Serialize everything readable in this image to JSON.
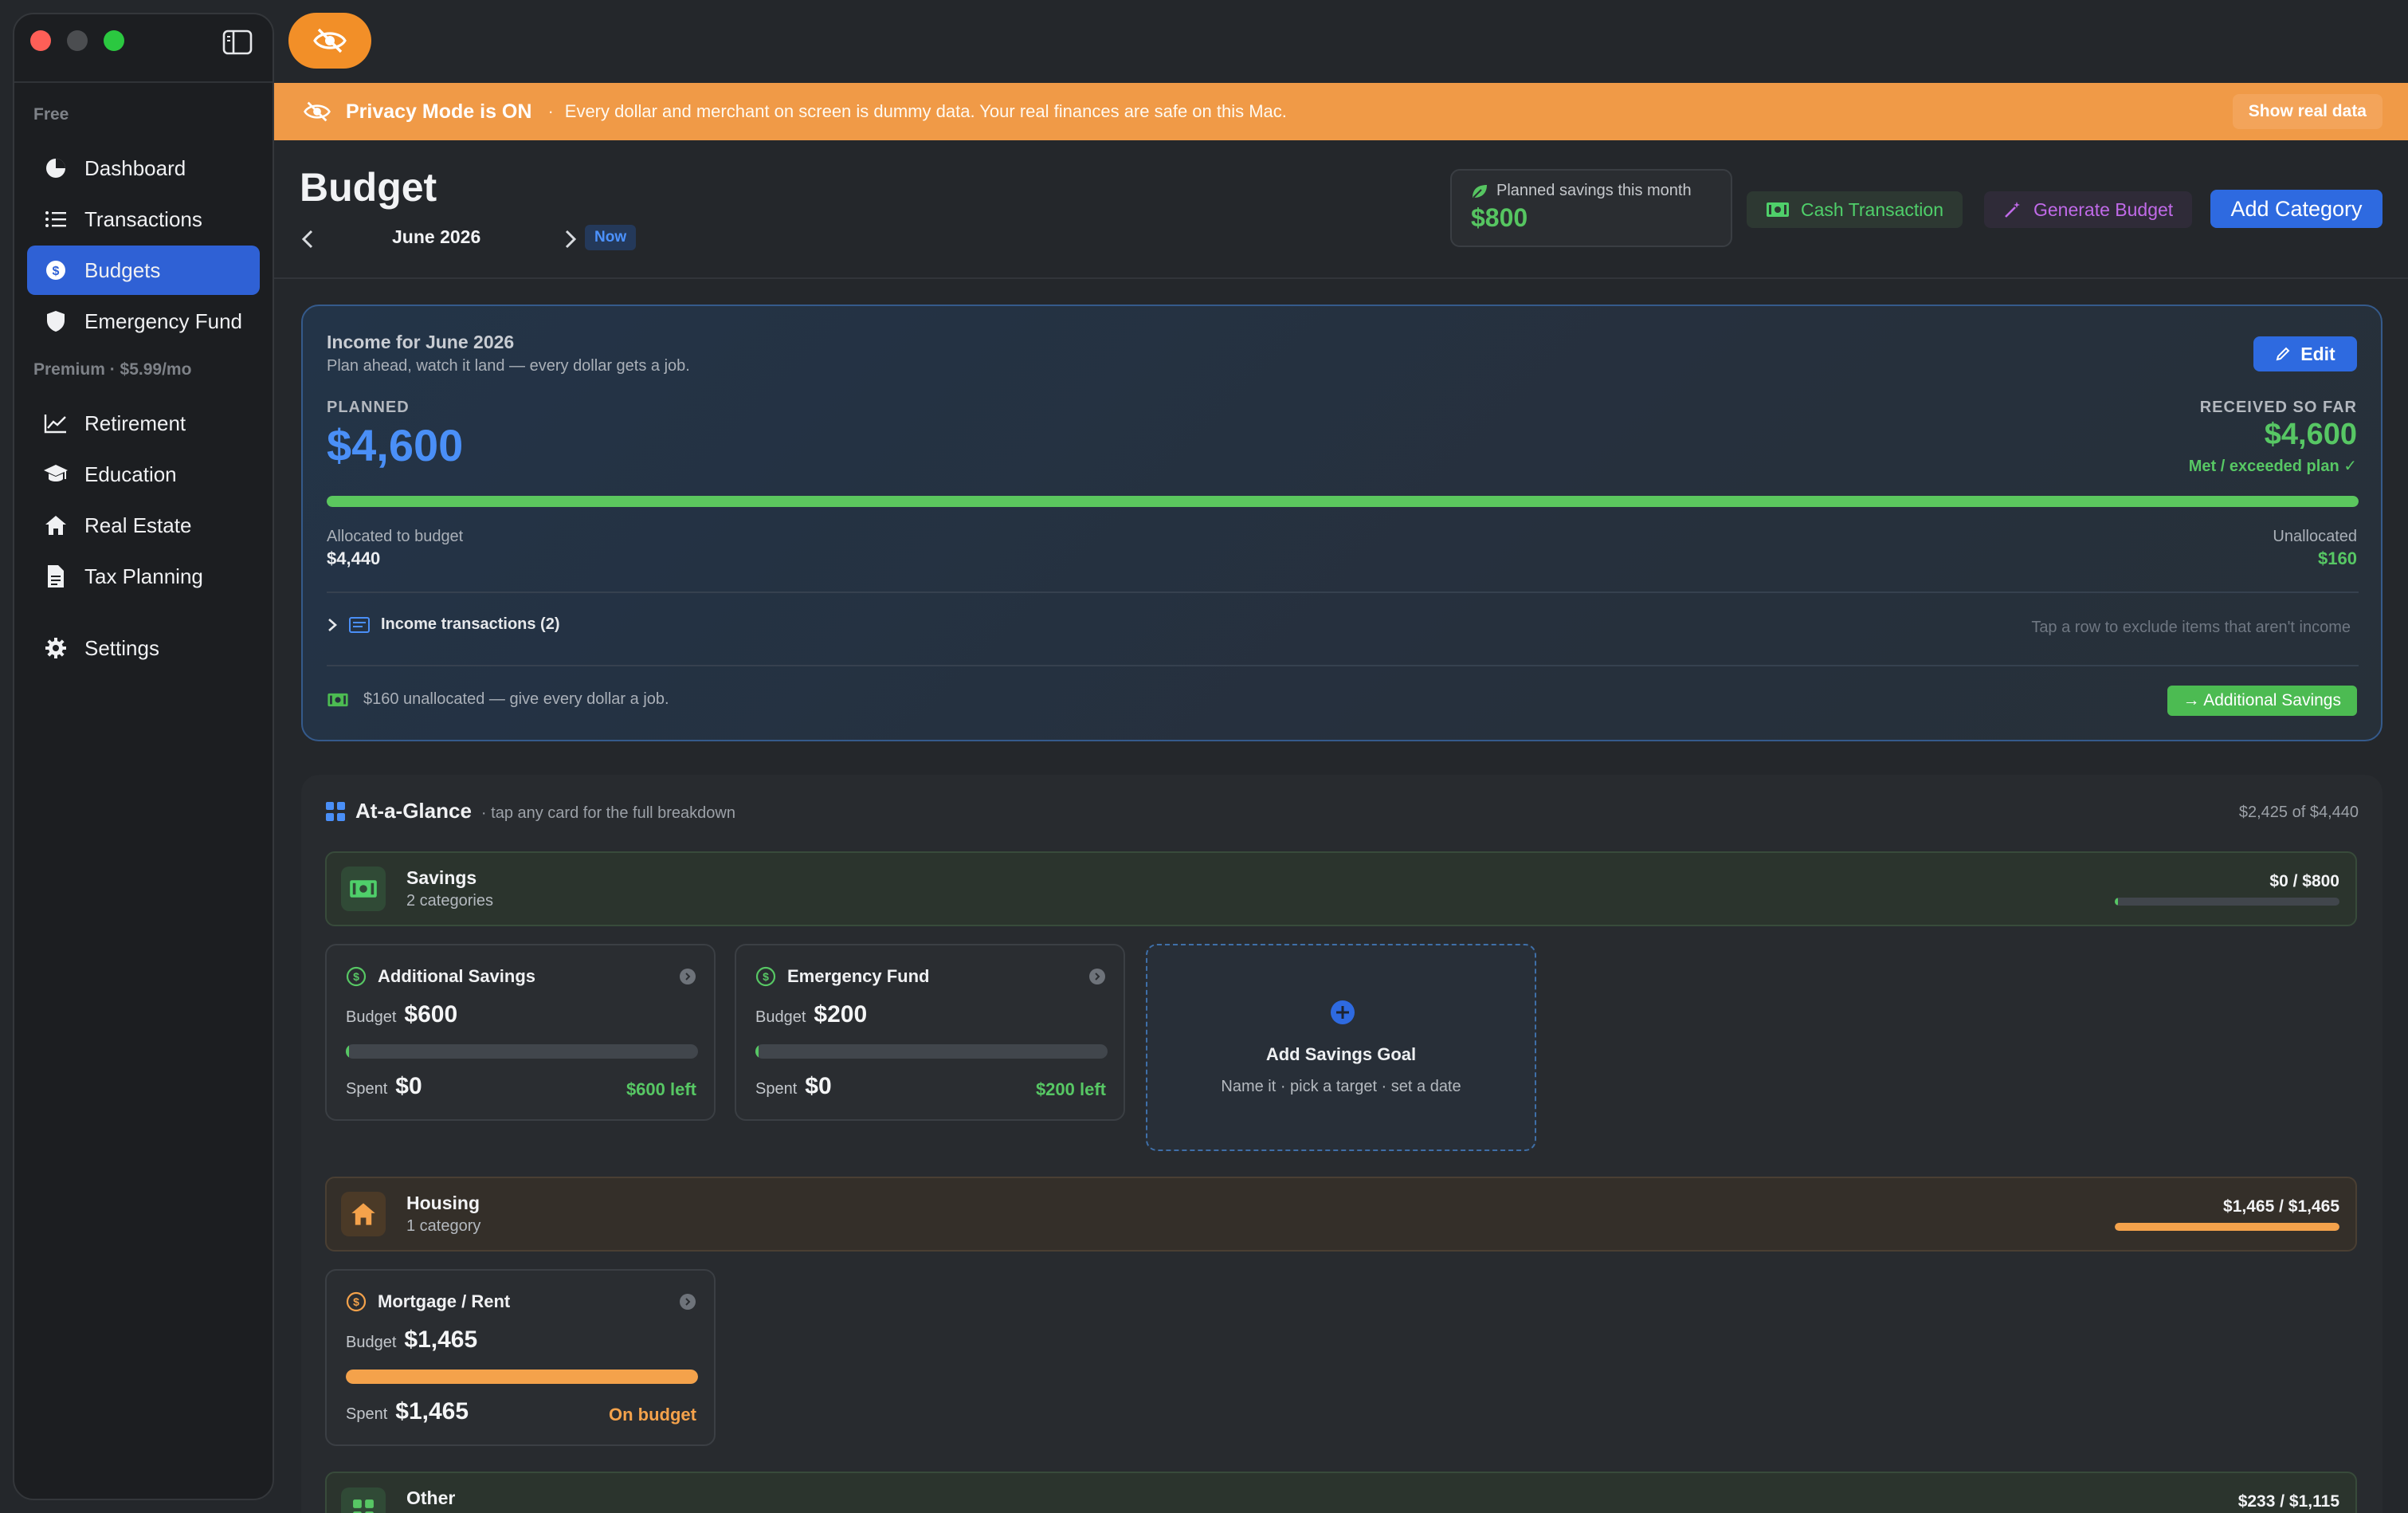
{
  "sidebar": {
    "sections": [
      {
        "title": "Free"
      },
      {
        "title": "Premium · $5.99/mo"
      }
    ],
    "items": [
      {
        "label": "Dashboard",
        "icon": "pie-chart-icon"
      },
      {
        "label": "Transactions",
        "icon": "list-icon"
      },
      {
        "label": "Budgets",
        "icon": "dollar-circle-icon",
        "active": true
      },
      {
        "label": "Emergency Fund",
        "icon": "shield-icon"
      },
      {
        "label": "Retirement",
        "icon": "line-chart-icon"
      },
      {
        "label": "Education",
        "icon": "graduation-cap-icon"
      },
      {
        "label": "Real Estate",
        "icon": "house-icon"
      },
      {
        "label": "Tax Planning",
        "icon": "document-icon"
      },
      {
        "label": "Settings",
        "icon": "gear-icon"
      }
    ]
  },
  "banner": {
    "title": "Privacy Mode is ON",
    "separator": "·",
    "message": "Every dollar and merchant on screen is dummy data. Your real finances are safe on this Mac.",
    "action": "Show real data"
  },
  "header": {
    "title": "Budget",
    "month": "June 2026",
    "now": "Now",
    "planned_savings_label": "Planned savings this month",
    "planned_savings_value": "$800",
    "cash_transaction": "Cash Transaction",
    "generate_budget": "Generate Budget",
    "add_category": "Add Category"
  },
  "income": {
    "title": "Income for June 2026",
    "subtitle": "Plan ahead, watch it land — every dollar gets a job.",
    "edit": "Edit",
    "planned_label": "PLANNED",
    "planned_value": "$4,600",
    "received_label": "RECEIVED SO FAR",
    "received_value": "$4,600",
    "met_label": "Met / exceeded plan ✓",
    "progress": 1.0,
    "allocated_label": "Allocated to budget",
    "allocated_value": "$4,440",
    "unallocated_label": "Unallocated",
    "unallocated_value": "$160",
    "transactions_label": "Income transactions (2)",
    "transactions_hint": "Tap a row to exclude items that aren't income",
    "unallocated_note": "$160 unallocated — give every dollar a job.",
    "additional_savings": "→ Additional Savings"
  },
  "glance": {
    "title": "At-a-Glance",
    "subtitle": "· tap any card for the full breakdown",
    "total": "$2,425 of $4,440",
    "groups": {
      "savings": {
        "name": "Savings",
        "count": "2 categories",
        "amount": "$0 / $800",
        "progress": 0.0
      },
      "housing": {
        "name": "Housing",
        "count": "1 category",
        "amount": "$1,465 / $1,465",
        "progress": 1.0
      },
      "other": {
        "name": "Other",
        "amount": "$233 / $1,115"
      }
    },
    "categories": {
      "additional_savings": {
        "name": "Additional Savings",
        "budget_label": "Budget",
        "budget": "$600",
        "spent_label": "Spent",
        "spent": "$0",
        "left": "$600 left",
        "progress": 0.0
      },
      "emergency_fund": {
        "name": "Emergency Fund",
        "budget_label": "Budget",
        "budget": "$200",
        "spent_label": "Spent",
        "spent": "$0",
        "left": "$200 left",
        "progress": 0.0
      },
      "mortgage": {
        "name": "Mortgage / Rent",
        "budget_label": "Budget",
        "budget": "$1,465",
        "spent_label": "Spent",
        "spent": "$1,465",
        "left": "On budget",
        "progress": 1.0
      }
    },
    "add_goal": {
      "title": "Add Savings Goal",
      "subtitle": "Name it · pick a target · set a date"
    }
  },
  "colors": {
    "accent_blue": "#2e6ae0",
    "green": "#57c764",
    "orange": "#f09a47",
    "purple": "#c06ae8"
  }
}
